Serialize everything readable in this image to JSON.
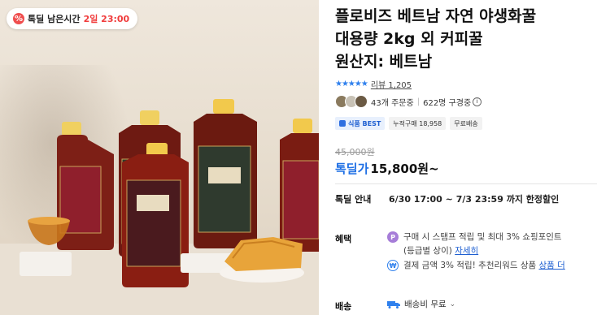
{
  "badge": {
    "label": "톡딜 남은시간",
    "time": "2일 23:00"
  },
  "product": {
    "title": "플로비즈 베트남 자연 야생화꿀\n대용량 2kg 외 커피꿀\n원산지: 베트남",
    "rating": 4.5,
    "review_text": "리뷰 1,205",
    "buyers_text": "43개 주문중",
    "subscribers_text": "622명 구경중",
    "tags": [
      "식품 BEST",
      "누적구매 18,958",
      "무료배송"
    ]
  },
  "price": {
    "original": "45,000원",
    "label": "톡딜가",
    "amount": "15,800원~"
  },
  "deal": {
    "key": "톡딜 안내",
    "value": "6/30 17:00 ~ 7/3 23:59 까지 한정할인"
  },
  "benefit": {
    "key": "혜택",
    "row1_text": "구매 시 스탬프 적립 및 최대 3% 쇼핑포인트",
    "row1_sub": "(등급별 상이)",
    "row1_link": "자세히",
    "row2_text": "결제 금액 3% 적립! 추천리워드 상품",
    "row2_link": "상품 더"
  },
  "shipping": {
    "key": "배송",
    "value": "배송비 무료"
  },
  "colors": {
    "accent": "#1f6fe5",
    "badge_red": "#f03c3c",
    "coin": "#a67dd8"
  }
}
